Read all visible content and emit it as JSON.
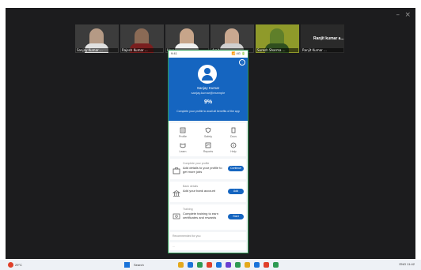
{
  "window": {
    "minimize_glyph": "–",
    "close_glyph": "×"
  },
  "participants": [
    {
      "caption": "Sanjay Kumar ...",
      "skin": "#b59a85",
      "shirt": "#e0e0e0"
    },
    {
      "caption": "Rajesh Kumar ...",
      "skin": "#8a6a55",
      "shirt": "#7a1f1f"
    },
    {
      "caption": "User ...",
      "skin": "#c7a58a",
      "shirt": "#f0f0f0"
    },
    {
      "caption": "Amit ...",
      "skin": "#c9a890",
      "shirt": "#d0d0d0"
    },
    {
      "caption": "Suresh Sharma ...",
      "skin": "#5f7f2a",
      "shirt": "#2f4f1f"
    },
    {
      "caption": "Ranjit Kumar ...",
      "skin": "#2a2a2a",
      "shirt": "#2a2a2a"
    }
  ],
  "featured_name": "Ranjit kumar a...",
  "phone": {
    "status_left": "9:41",
    "status_right": "📶 4G 🔋",
    "menu_glyph": "⋮",
    "profile_name": "Sanjay Kumar",
    "profile_sub": "sanjay.kumar@example",
    "percent": "9%",
    "percent_message": "Complete your profile to avail all benefits of the app",
    "grid": [
      {
        "icon": "id-card-icon",
        "label": "Profile"
      },
      {
        "icon": "shield-icon",
        "label": "Safety"
      },
      {
        "icon": "document-icon",
        "label": "Docs"
      },
      {
        "icon": "book-icon",
        "label": "Learn"
      },
      {
        "icon": "chart-icon",
        "label": "Reports"
      },
      {
        "icon": "help-icon",
        "label": "Help"
      }
    ],
    "cards": [
      {
        "icon": "briefcase-icon",
        "caption": "Complete your profile",
        "text": "Add details to your profile to get more jobs",
        "button": "Continue"
      },
      {
        "icon": "bank-icon",
        "caption": "Bank details",
        "text": "Add your bank account",
        "button": "Add"
      },
      {
        "icon": "certificate-icon",
        "caption": "Training",
        "text": "Complete training to earn certificates and rewards",
        "button": "Start"
      }
    ],
    "footer_caption": "Recommended for you",
    "footer_input": "..."
  },
  "taskbar": {
    "weather": "29°C",
    "search": "Search",
    "app_colors": [
      "#e4a91c",
      "#1a73d9",
      "#2e9a52",
      "#e0402a",
      "#1a73d9",
      "#6a3fd0",
      "#2e9a52",
      "#e4a91c",
      "#1a73d9",
      "#e0402a",
      "#2e9a52"
    ],
    "clock": "ENG  11:42"
  }
}
